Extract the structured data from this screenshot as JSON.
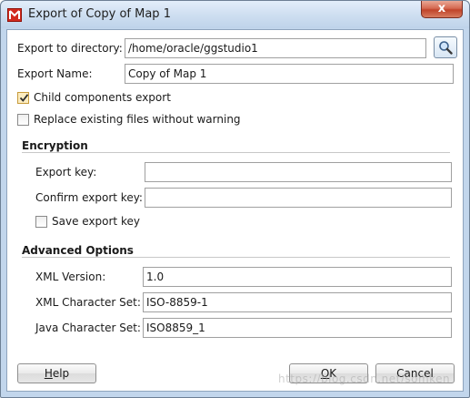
{
  "window": {
    "title": "Export of Copy of Map 1",
    "close_symbol": "x"
  },
  "form": {
    "export_dir_label": "Export to directory:",
    "export_dir_value": "/home/oracle/ggstudio1",
    "export_name_label": "Export Name:",
    "export_name_value": "Copy of Map 1",
    "child_components_label": "Child components export",
    "child_components_checked": true,
    "replace_files_label": "Replace existing files without warning",
    "replace_files_checked": false
  },
  "encryption": {
    "section_title": "Encryption",
    "export_key_label": "Export key:",
    "export_key_value": "",
    "confirm_key_label": "Confirm export key:",
    "confirm_key_value": "",
    "save_key_label": "Save export key",
    "save_key_checked": false
  },
  "advanced": {
    "section_title": "Advanced Options",
    "xml_version_label": "XML Version:",
    "xml_version_value": "1.0",
    "xml_charset_label": "XML Character Set:",
    "xml_charset_value": "ISO-8859-1",
    "java_charset_label": "Java Character Set:",
    "java_charset_value": "ISO8859_1"
  },
  "buttons": {
    "help_mnemonic": "H",
    "help_rest": "elp",
    "ok_mnemonic": "O",
    "ok_rest": "K",
    "cancel_label": "Cancel"
  },
  "watermark": "https://blog.csdn.net/somken",
  "colors": {
    "titlebar": "#cfdff1",
    "close_button": "#c9503a",
    "check_fill": "#fcecc0",
    "app_icon": "#d22a1e"
  },
  "icons": {
    "app": "odi-app-icon",
    "browse": "magnifier-icon",
    "check": "checkmark-icon"
  }
}
